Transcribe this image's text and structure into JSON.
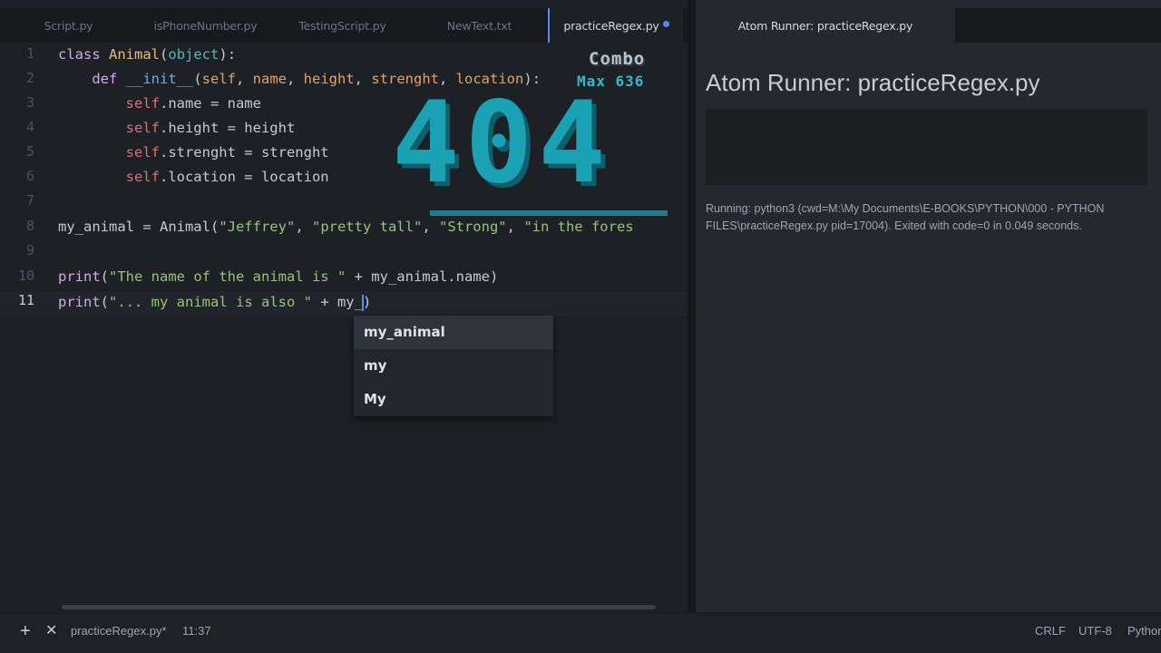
{
  "tabs": [
    {
      "label": "Script.py"
    },
    {
      "label": "isPhoneNumber.py"
    },
    {
      "label": "TestingScript.py"
    },
    {
      "label": "NewText.txt"
    },
    {
      "label": "practiceRegex.py"
    }
  ],
  "line_numbers": [
    "1",
    "2",
    "3",
    "4",
    "5",
    "6",
    "7",
    "8",
    "9",
    "10",
    "11"
  ],
  "code": {
    "l1": {
      "kw": "class",
      "cls": "Animal",
      "p1": "(",
      "bi": "object",
      "p2": "):"
    },
    "l2": {
      "indent": "    ",
      "kw": "def",
      "fn": "__init__",
      "p1": "(",
      "slf": "self",
      "rest1": ", ",
      "a1": "name",
      "c1": ", ",
      "a2": "height",
      "c2": ", ",
      "a3": "strenght",
      "c3": ", ",
      "a4": "location",
      "p2": "):"
    },
    "l3": {
      "indent": "        ",
      "slf": "self",
      "rest": ".name = name"
    },
    "l4": {
      "indent": "        ",
      "slf": "self",
      "rest": ".height = height"
    },
    "l5": {
      "indent": "        ",
      "slf": "self",
      "rest": ".strenght = strenght"
    },
    "l6": {
      "indent": "        ",
      "slf": "self",
      "rest": ".location = location"
    },
    "l8": {
      "pre": "my_animal = Animal(",
      "s1": "\"Jeffrey\"",
      "c1": ", ",
      "s2": "\"pretty tall\"",
      "c2": ", ",
      "s3": "\"Strong\"",
      "c3": ", ",
      "s4": "\"in the fores"
    },
    "l10": {
      "fn": "print",
      "p1": "(",
      "s1": "\"The name of the animal is \"",
      "rest": " + my_animal.name)"
    },
    "l11": {
      "fn": "print",
      "p1": "(",
      "s1": "\"... my animal is also \"",
      "rest": " + my_",
      "tail": ")"
    }
  },
  "autocomplete": {
    "items": [
      "my_animal",
      "my",
      "My"
    ],
    "selected_index": 0
  },
  "combo": {
    "title": "Combo",
    "max": "Max 636",
    "count": "404"
  },
  "runner": {
    "tab_label": "Atom Runner: practiceRegex.py",
    "title": "Atom Runner: practiceRegex.py",
    "status": "Running: python3 (cwd=M:\\My Documents\\E-BOOKS\\PYTHON\\000 - PYTHON FILES\\practiceRegex.py pid=17004). Exited with code=0 in 0.049 seconds."
  },
  "statusbar": {
    "add_icon": "+",
    "close_icon": "✕",
    "file": "practiceRegex.py*",
    "cursor_position": "11:37",
    "line_ending": "CRLF",
    "encoding": "UTF-8",
    "grammar": "Python"
  },
  "colors": {
    "accent": "#568af2",
    "combo": "#1aa2b4"
  }
}
